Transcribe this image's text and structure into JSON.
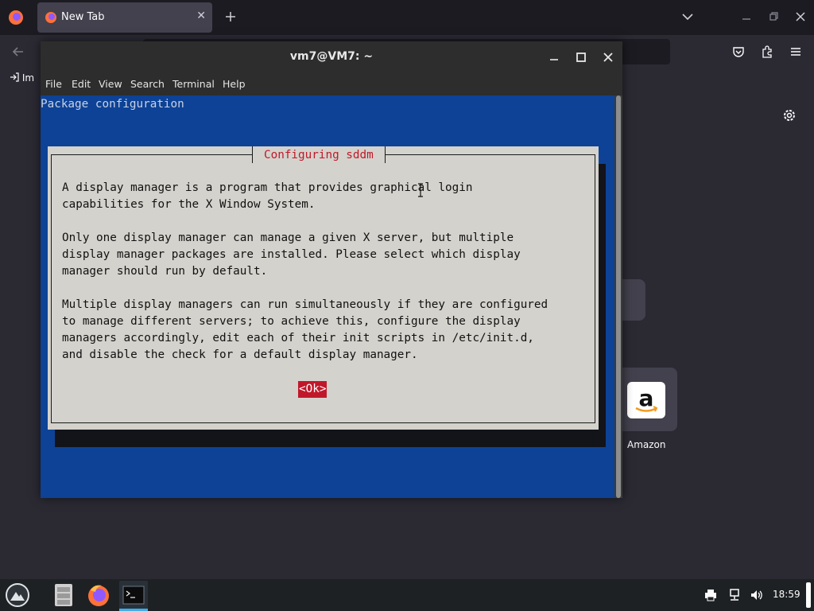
{
  "firefox": {
    "tab_label": "New Tab",
    "import_label": "Im",
    "shortcuts": [
      {
        "label": "Amazon",
        "icon": "amazon-icon"
      }
    ],
    "icons": [
      "firefox-menu-icon",
      "firefox-icon",
      "close-icon",
      "plus-icon",
      "chevron-down-icon",
      "minimize-icon",
      "restore-icon",
      "close-icon",
      "back-arrow-icon",
      "pocket-icon",
      "extensions-icon",
      "hamburger-menu-icon",
      "import-icon",
      "gear-icon"
    ],
    "accent_color": "#42414d"
  },
  "terminal": {
    "title": "vm7@VM7: ~",
    "menu": [
      "File",
      "Edit",
      "View",
      "Search",
      "Terminal",
      "Help"
    ],
    "screen_title": "Package configuration",
    "dialog": {
      "title": "Configuring sddm",
      "lines": [
        "A display manager is a program that provides graphical login",
        "capabilities for the X Window System.",
        "",
        "Only one display manager can manage a given X server, but multiple",
        "display manager packages are installed. Please select which display",
        "manager should run by default.",
        "",
        "Multiple display managers can run simultaneously if they are configured",
        "to manage different servers; to achieve this, configure the display",
        "managers accordingly, edit each of their init scripts in /etc/init.d,",
        "and disable the check for a default display manager."
      ],
      "ok_label": "<Ok>"
    },
    "colors": {
      "screen_bg": "#0d4296",
      "dialog_bg": "#d4d2cc",
      "title_fg": "#c0182a",
      "button_bg": "#c0182a"
    }
  },
  "taskbar": {
    "clock": "18:59",
    "apps": [
      "application-launcher-icon",
      "file-manager-icon",
      "firefox-icon",
      "terminal-icon"
    ],
    "tray": [
      "printer-icon",
      "network-icon",
      "volume-icon"
    ]
  }
}
